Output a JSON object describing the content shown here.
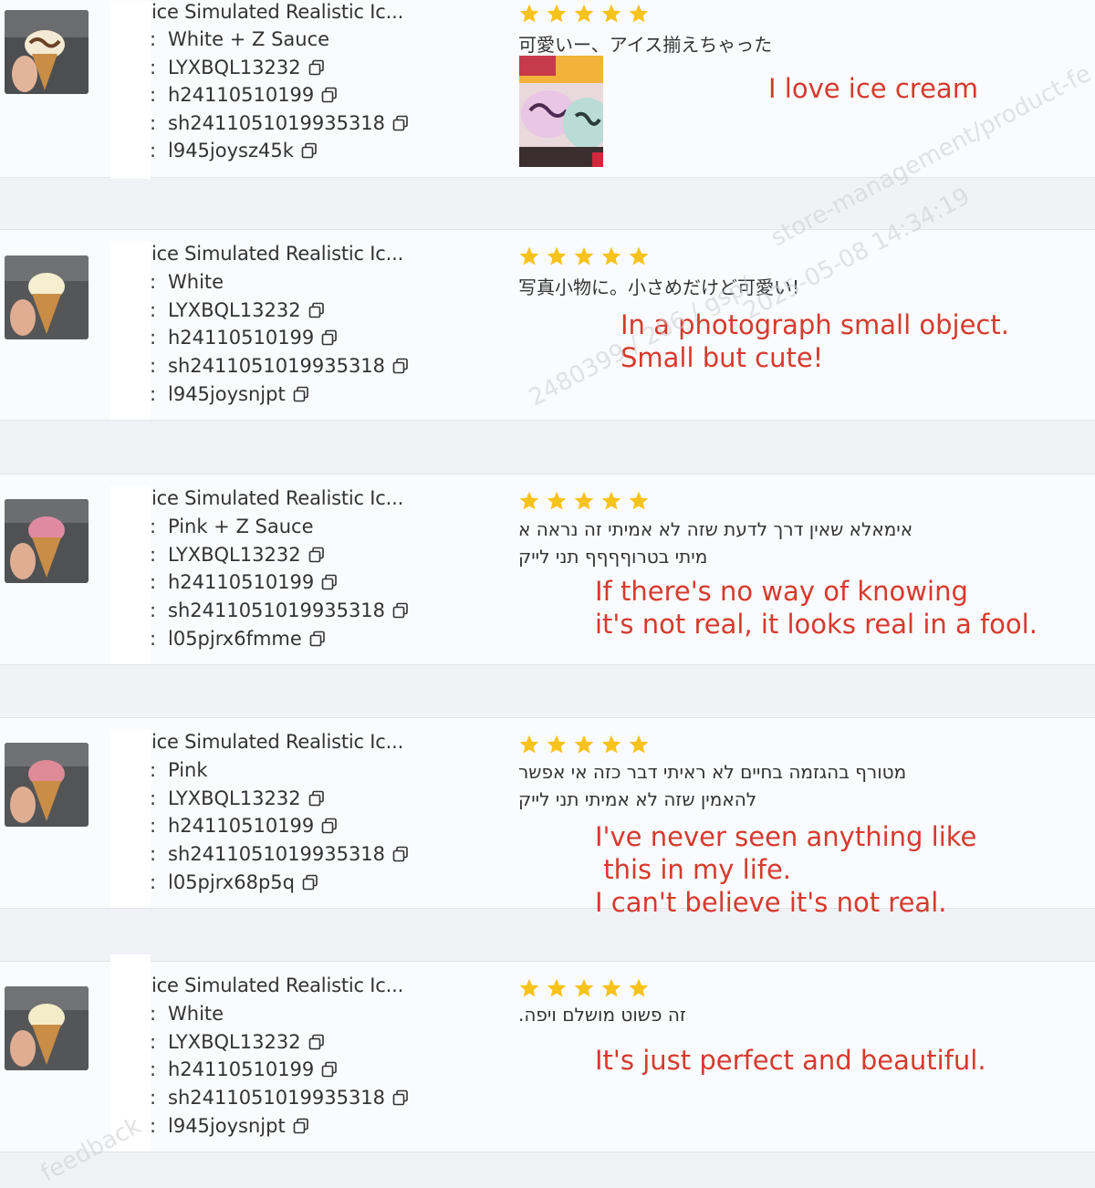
{
  "product_title": "ice Simulated Realistic Ic...",
  "stars_color": "#f6c21c",
  "translation_color": "#d63a2e",
  "watermarks": [
    "store-management/product-fe",
    "2025-05-08 14:34:19",
    "2480399 / 206 / gsp/",
    "feedback"
  ],
  "reviews": [
    {
      "variant": "White + Z Sauce",
      "sku": "LYXBQL13232",
      "goods_id": "h24110510199",
      "order_id": "sh2411051019935318",
      "review_id": "l945joysz45k",
      "rating": 5,
      "original": "可愛いー、アイス揃えちゃった",
      "original2": "",
      "translation": "I love ice cream"
    },
    {
      "variant": "White",
      "sku": "LYXBQL13232",
      "goods_id": "h24110510199",
      "order_id": "sh2411051019935318",
      "review_id": "l945joysnjpt",
      "rating": 5,
      "original": "写真小物に。小さめだけど可愛い!",
      "original2": "",
      "translation": "In a photograph small object.\nSmall but cute!"
    },
    {
      "variant": "Pink + Z Sauce",
      "sku": "LYXBQL13232",
      "goods_id": "h24110510199",
      "order_id": "sh2411051019935318",
      "review_id": "l05pjrx6fmme",
      "rating": 5,
      "original": "אימאלא שאין דרך לדעת שזה לא אמיתי זה נראה א",
      "original2": "מיתי בטרוףףףף תני לייק",
      "translation": "If there's no way of knowing\nit's not real, it looks real in a fool."
    },
    {
      "variant": "Pink",
      "sku": "LYXBQL13232",
      "goods_id": "h24110510199",
      "order_id": "sh2411051019935318",
      "review_id": "l05pjrx68p5q",
      "rating": 5,
      "original": "מטורף בהגזמה בחיים לא ראיתי דבר כזה אי אפשר",
      "original2": "להאמין שזה לא אמיתי תני לייק",
      "translation": "I've never seen anything like\n this in my life.\nI can't believe it's not real."
    },
    {
      "variant": "White",
      "sku": "LYXBQL13232",
      "goods_id": "h24110510199",
      "order_id": "sh2411051019935318",
      "review_id": "l945joysnjpt",
      "rating": 5,
      "original": "זה פשוט מושלם ויפה.",
      "original2": "",
      "translation": "It's just perfect and beautiful."
    }
  ]
}
